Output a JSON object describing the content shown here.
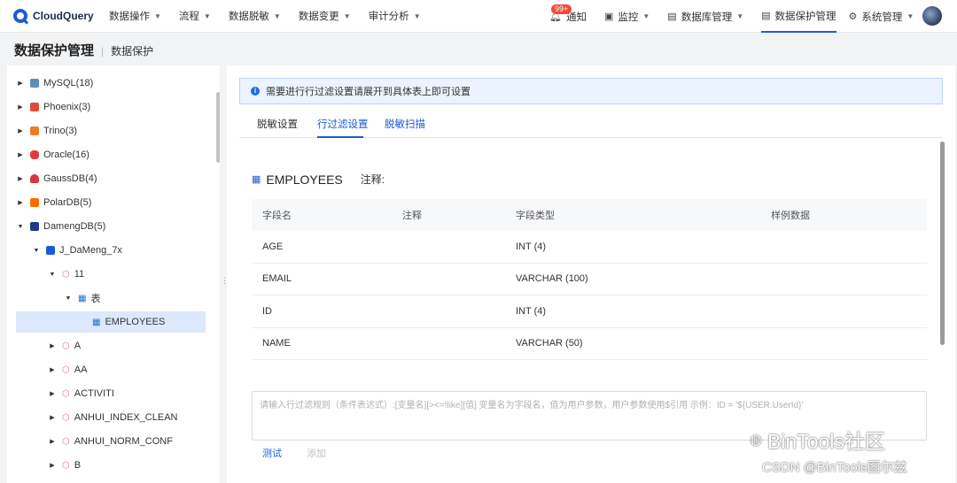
{
  "app": {
    "name": "CloudQuery"
  },
  "nav": {
    "left": [
      {
        "label": "数据操作"
      },
      {
        "label": "流程"
      },
      {
        "label": "数据脱敏"
      },
      {
        "label": "数据变更"
      },
      {
        "label": "审计分析"
      }
    ],
    "notify_badge": "99+",
    "notify_label": "通知",
    "monitor": "监控",
    "db_manage": "数据库管理",
    "data_protect": "数据保护管理",
    "system": "系统管理"
  },
  "page": {
    "title": "数据保护管理",
    "subtitle": "数据保护"
  },
  "tree": [
    {
      "label": "MySQL(18)",
      "color": "#5b8fb9"
    },
    {
      "label": "Phoenix(3)",
      "color": "#e04b3a"
    },
    {
      "label": "Trino(3)",
      "color": "#f07b22"
    },
    {
      "label": "Oracle(16)",
      "color": "#e03a3a"
    },
    {
      "label": "GaussDB(4)",
      "color": "#d9363e"
    },
    {
      "label": "PolarDB(5)",
      "color": "#ff6a00"
    },
    {
      "label": "DamengDB(5)",
      "color": "#1b3a8a"
    },
    {
      "label": "J_DaMeng_7x",
      "color": "#1b5bd6"
    },
    {
      "label": "11"
    },
    {
      "label": "表"
    },
    {
      "label": "EMPLOYEES"
    },
    {
      "label": "A"
    },
    {
      "label": "AA"
    },
    {
      "label": "ACTIVITI"
    },
    {
      "label": "ANHUI_INDEX_CLEAN"
    },
    {
      "label": "ANHUI_NORM_CONF"
    },
    {
      "label": "B"
    }
  ],
  "notice": "需要进行行过滤设置请展开到具体表上即可设置",
  "tabs": {
    "t1": "脱敏设置",
    "t2": "行过滤设置",
    "t3": "脱敏扫描"
  },
  "table": {
    "name": "EMPLOYEES",
    "note_label": "注释:",
    "headers": {
      "field": "字段名",
      "comment": "注释",
      "type": "字段类型",
      "sample": "样例数据"
    },
    "rows": [
      {
        "field": "AGE",
        "comment": "",
        "type": "INT (4)",
        "sample": ""
      },
      {
        "field": "EMAIL",
        "comment": "",
        "type": "VARCHAR (100)",
        "sample": ""
      },
      {
        "field": "ID",
        "comment": "",
        "type": "INT (4)",
        "sample": ""
      },
      {
        "field": "NAME",
        "comment": "",
        "type": "VARCHAR (50)",
        "sample": ""
      }
    ]
  },
  "rule_placeholder": "请输入行过滤规则（条件表达式）:[变量名][><=!like][值] 变量名为字段名，值为用户参数，用户参数使用$引用 示例：ID = '${USER.UserId}'",
  "actions": {
    "test": "测试",
    "add": "添加"
  },
  "watermark": {
    "line1": "BinTools社区",
    "line2": "CSDN @BinTools图尔兹"
  }
}
